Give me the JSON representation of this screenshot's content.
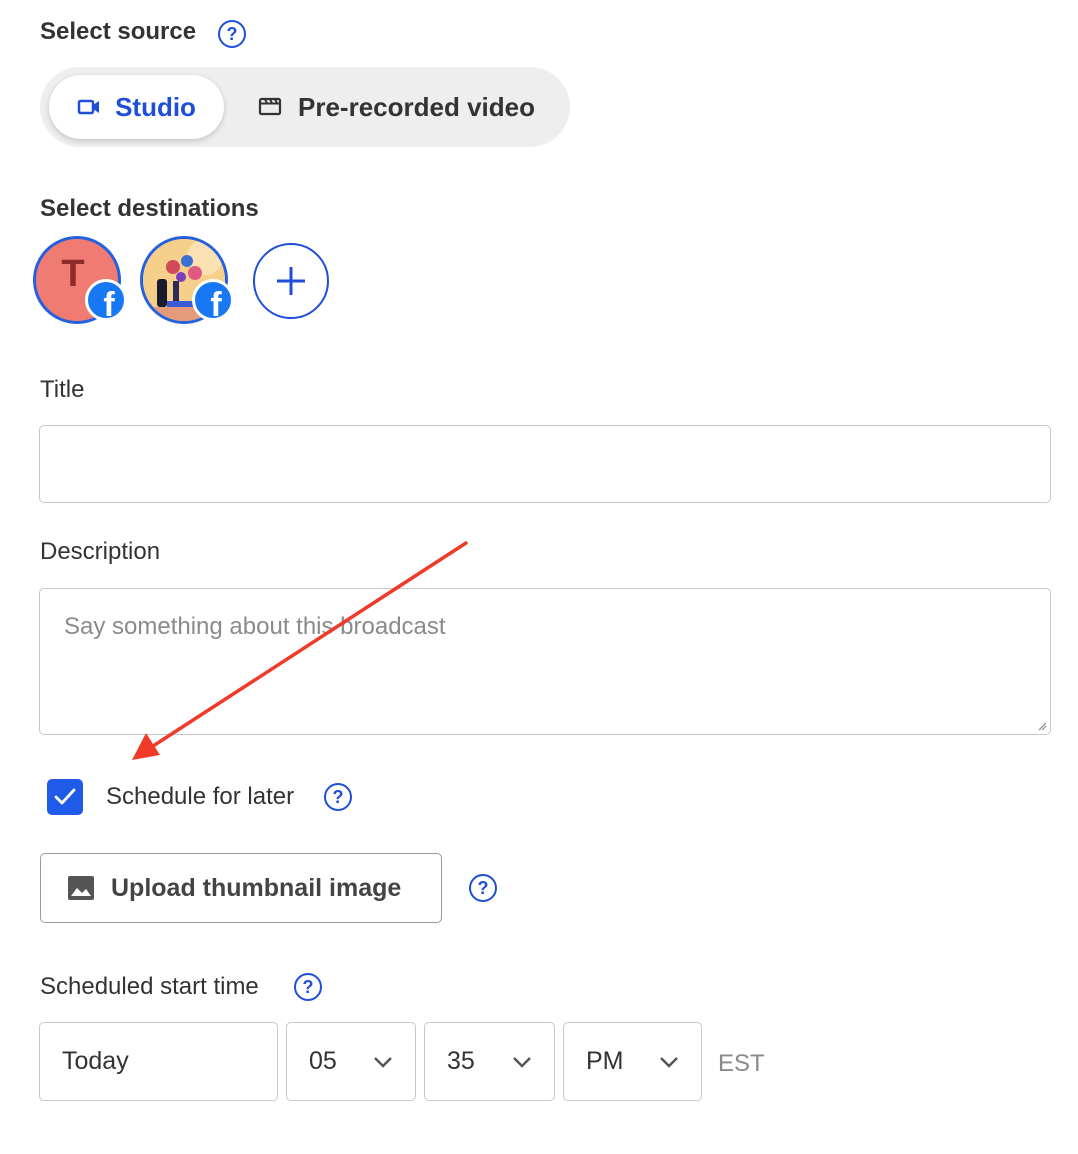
{
  "source": {
    "label": "Select source",
    "options": [
      {
        "label": "Studio",
        "icon": "video-camera-icon",
        "selected": true
      },
      {
        "label": "Pre-recorded video",
        "icon": "film-icon",
        "selected": false
      }
    ]
  },
  "destinations": {
    "label": "Select destinations",
    "items": [
      {
        "initial": "T",
        "network": "facebook",
        "avatar_color": "#ef7b72"
      },
      {
        "initial": "",
        "network": "facebook",
        "avatar_color": "#f3c37a"
      }
    ]
  },
  "title_field": {
    "label": "Title",
    "value": ""
  },
  "description_field": {
    "label": "Description",
    "placeholder": "Say something about this broadcast"
  },
  "schedule": {
    "label": "Schedule for later",
    "checked": true
  },
  "upload": {
    "label": "Upload thumbnail image"
  },
  "start_time": {
    "label": "Scheduled start time",
    "date": "Today",
    "hour": "05",
    "minute": "35",
    "meridiem": "PM",
    "timezone": "EST"
  },
  "colors": {
    "accent": "#1f4fd8",
    "checkbox": "#1f5ae8",
    "annotation_arrow": "#f03a2a",
    "facebook": "#1877f2"
  }
}
